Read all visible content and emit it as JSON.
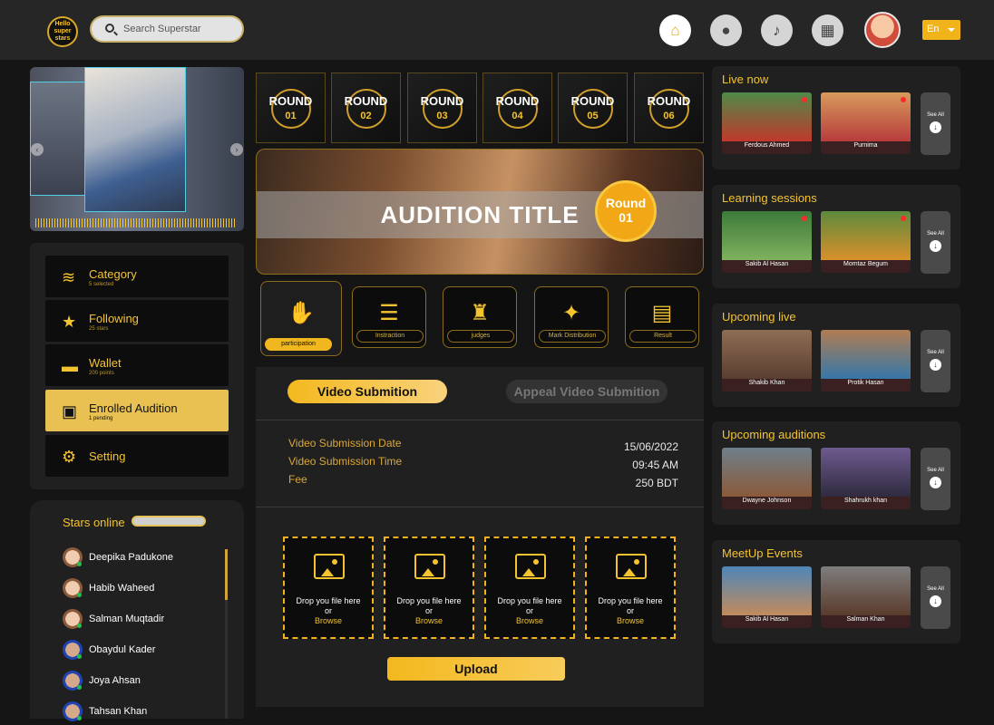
{
  "header": {
    "logo": "Hello super stars",
    "search_placeholder": "Search Superstar",
    "lang": "En"
  },
  "menu": [
    {
      "label": "Category",
      "sub": "5 selected"
    },
    {
      "label": "Following",
      "sub": "25 stars"
    },
    {
      "label": "Wallet",
      "sub": "200 points"
    },
    {
      "label": "Enrolled Audition",
      "sub": "1 pending"
    },
    {
      "label": "Setting",
      "sub": ""
    }
  ],
  "stars": {
    "title": "Stars online",
    "list": [
      "Deepika Padukone",
      "Habib Waheed",
      "Salman Muqtadir",
      "Obaydul Kader",
      "Joya Ahsan",
      "Tahsan Khan"
    ]
  },
  "rounds": [
    {
      "label": "ROUND",
      "num": "01"
    },
    {
      "label": "ROUND",
      "num": "02"
    },
    {
      "label": "ROUND",
      "num": "03"
    },
    {
      "label": "ROUND",
      "num": "04"
    },
    {
      "label": "ROUND",
      "num": "05"
    },
    {
      "label": "ROUND",
      "num": "06"
    }
  ],
  "hero": {
    "title": "AUDITION TITLE",
    "badge_label": "Round",
    "badge_num": "01"
  },
  "tabs": [
    "participation",
    "Instraction",
    "judges",
    "Mark Distribution",
    "Result"
  ],
  "submission": {
    "active": "Video Submition",
    "inactive": "Appeal Video Submition",
    "date_label": "Video Submission Date",
    "time_label": "Video Submission Time",
    "fee_label": "Fee",
    "date": "15/06/2022",
    "time": "09:45 AM",
    "fee": "250 BDT",
    "drop_text1": "Drop you file here",
    "drop_or": "or",
    "drop_browse": "Browse",
    "upload": "Upload"
  },
  "sections": [
    {
      "title": "Live now",
      "cards": [
        "Ferdous Ahmed",
        "Purnima"
      ]
    },
    {
      "title": "Learning sessions",
      "cards": [
        "Sakib Al Hasan",
        "Momtaz Begum"
      ]
    },
    {
      "title": "Upcoming live",
      "cards": [
        "Shakib Khan",
        "Protik Hasan"
      ]
    },
    {
      "title": "Upcoming auditions",
      "cards": [
        "Dwayne Johnson",
        "Shahrukh khan"
      ]
    },
    {
      "title": "MeetUp Events",
      "cards": [
        "Sakib Al Hasan",
        "Salman Khan"
      ]
    }
  ],
  "see_all": "See All"
}
